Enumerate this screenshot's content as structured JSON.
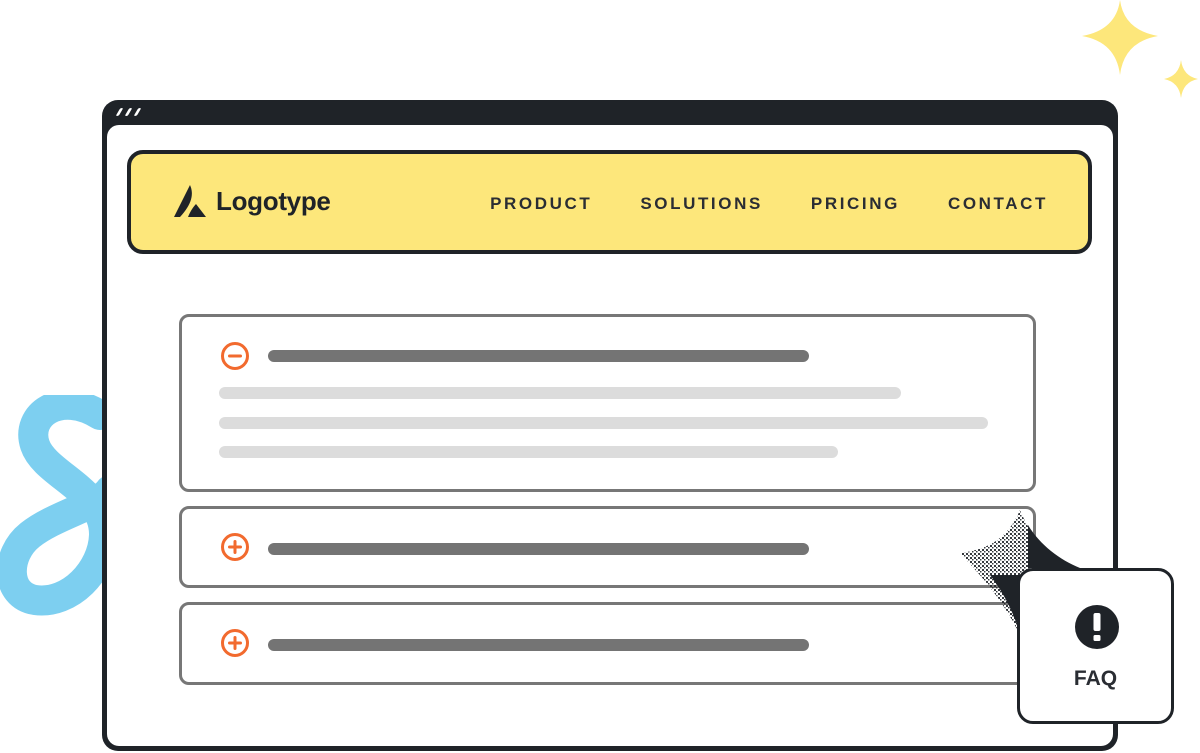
{
  "colors": {
    "frame": "#1f2328",
    "navbar_bg": "#fde77b",
    "accent_orange": "#f26a2e",
    "accordion_border": "#777777",
    "title_placeholder": "#747474",
    "body_placeholder": "#dcdcdc",
    "squiggle_blue": "#7dcff0",
    "sparkle_yellow": "#fde77b"
  },
  "navbar": {
    "logo_text": "Logotype",
    "links": [
      {
        "label": "PRODUCT"
      },
      {
        "label": "SOLUTIONS"
      },
      {
        "label": "PRICING"
      },
      {
        "label": "CONTACT"
      }
    ]
  },
  "accordion": {
    "items": [
      {
        "state": "expanded",
        "icon": "minus-circle-icon",
        "body_lines": 3
      },
      {
        "state": "collapsed",
        "icon": "plus-circle-icon",
        "body_lines": 0
      },
      {
        "state": "collapsed",
        "icon": "plus-circle-icon",
        "body_lines": 0
      }
    ]
  },
  "faq_badge": {
    "icon": "exclamation-circle-icon",
    "label": "FAQ"
  }
}
